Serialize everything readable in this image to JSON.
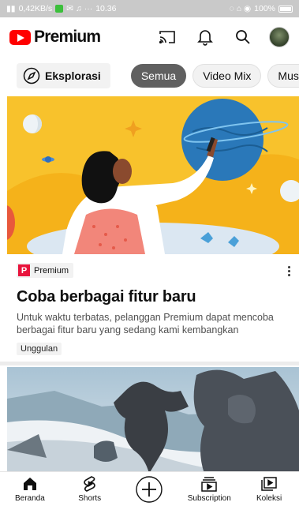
{
  "status_bar": {
    "left": "0,42KB/s",
    "time": "10.36",
    "right": "100%"
  },
  "header": {
    "logo_text": "Premium",
    "icons": [
      "cast-icon",
      "bell-icon",
      "search-icon",
      "avatar"
    ]
  },
  "chips": {
    "explore": "Eksplorasi",
    "items": [
      {
        "label": "Semua",
        "active": true
      },
      {
        "label": "Video Mix",
        "active": false
      },
      {
        "label": "Musik",
        "active": false
      }
    ]
  },
  "card": {
    "badge": "Premium",
    "badge_letter": "P",
    "title": "Coba berbagai fitur baru",
    "description": "Untuk waktu terbatas, pelanggan Premium dapat mencoba berbagai fitur baru yang sedang kami kembangkan",
    "tag": "Unggulan"
  },
  "bottom_nav": {
    "items": [
      {
        "label": "Beranda",
        "icon": "home-icon"
      },
      {
        "label": "Shorts",
        "icon": "shorts-icon"
      },
      {
        "label": "",
        "icon": "create-icon"
      },
      {
        "label": "Subscription",
        "icon": "subscriptions-icon"
      },
      {
        "label": "Koleksi",
        "icon": "library-icon"
      }
    ]
  },
  "colors": {
    "brand_red": "#ff0000",
    "hero_yellow": "#f8c22c",
    "active_chip": "#606060"
  }
}
